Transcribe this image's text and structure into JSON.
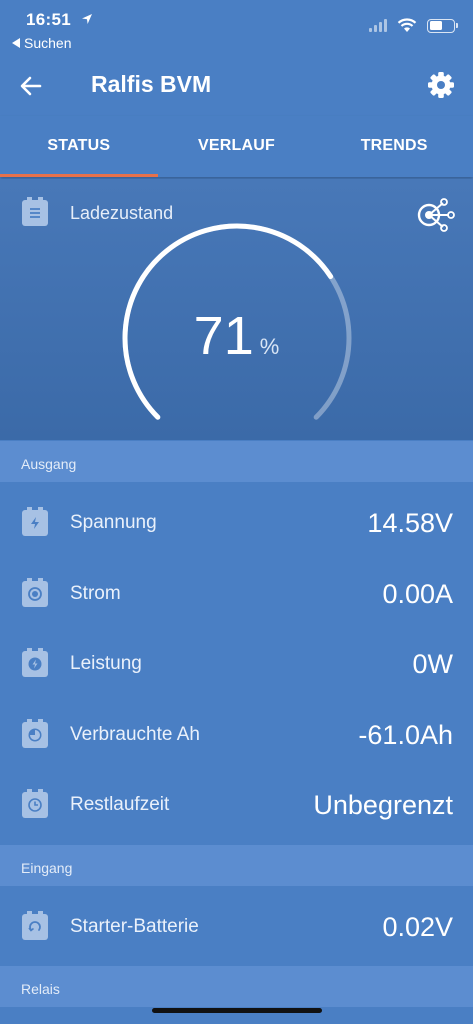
{
  "status_bar": {
    "time": "16:51",
    "back_app": "Suchen"
  },
  "app_bar": {
    "title": "Ralfis BVM"
  },
  "tabs": [
    {
      "label": "STATUS",
      "active": true
    },
    {
      "label": "VERLAUF",
      "active": false
    },
    {
      "label": "TRENDS",
      "active": false
    }
  ],
  "gauge": {
    "label": "Ladezustand",
    "value": "71",
    "unit": "%",
    "fraction": 0.71
  },
  "sections": {
    "ausgang": "Ausgang",
    "eingang": "Eingang",
    "relais": "Relais"
  },
  "rows": [
    {
      "label": "Spannung",
      "value": "14.58V",
      "icon": "bolt-icon"
    },
    {
      "label": "Strom",
      "value": "0.00A",
      "icon": "current-icon"
    },
    {
      "label": "Leistung",
      "value": "0W",
      "icon": "power-icon"
    },
    {
      "label": "Verbrauchte Ah",
      "value": "-61.0Ah",
      "icon": "consumed-ah-icon"
    },
    {
      "label": "Restlaufzeit",
      "value": "Unbegrenzt",
      "icon": "clock-icon"
    }
  ],
  "eingang_rows": [
    {
      "label": "Starter-Batterie",
      "value": "0.02V",
      "icon": "starter-battery-icon"
    }
  ],
  "colors": {
    "background": "#4a7fc4",
    "accent_tab": "#e8714a",
    "section_header": "#5c8dd0"
  }
}
